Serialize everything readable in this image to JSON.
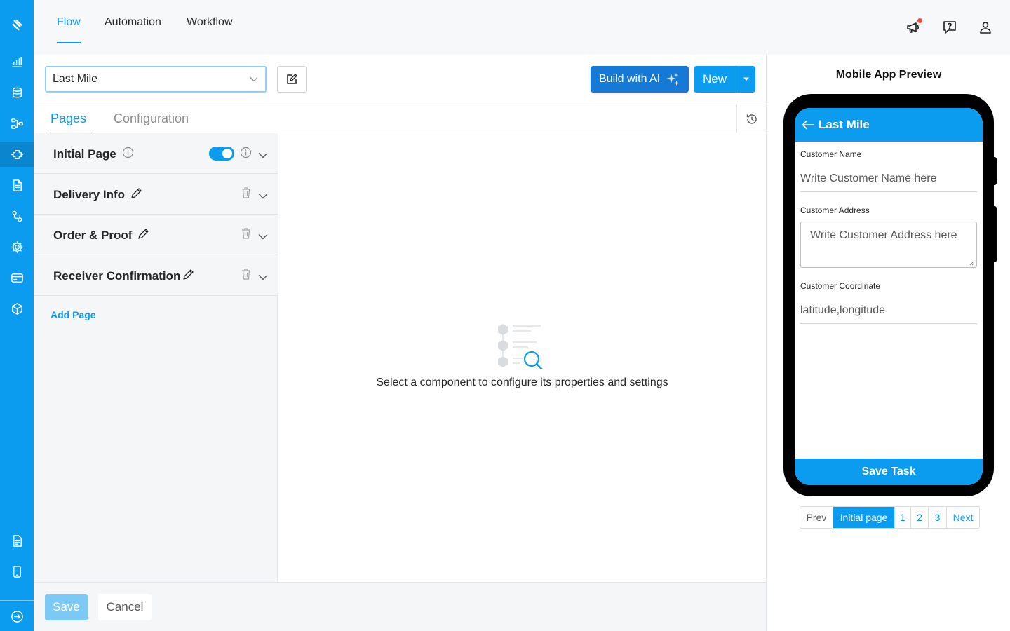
{
  "top_nav": {
    "tabs": [
      {
        "label": "Flow",
        "active": true
      },
      {
        "label": "Automation",
        "active": false
      },
      {
        "label": "Workflow",
        "active": false
      }
    ],
    "icons": [
      "megaphone-icon",
      "help-chat-icon",
      "user-icon"
    ]
  },
  "sidebar": {
    "icons": [
      "logo-icon",
      "analytics-icon",
      "database-icon",
      "flow-icon",
      "integration-icon",
      "document-icon",
      "route-icon",
      "settings-icon",
      "billing-icon",
      "package-icon",
      "notes-icon",
      "mobile-icon",
      "expand-icon"
    ],
    "active": "integration-icon"
  },
  "toolbar": {
    "flow_select_value": "Last Mile",
    "build_ai_label": "Build with AI",
    "new_label": "New"
  },
  "tabs": {
    "pages_label": "Pages",
    "configuration_label": "Configuration",
    "active": "Pages"
  },
  "pages": {
    "items": [
      {
        "label": "Initial Page",
        "enabled": true
      },
      {
        "label": "Delivery Info"
      },
      {
        "label": "Order & Proof"
      },
      {
        "label": "Receiver Confirmation"
      }
    ],
    "add_label": "Add Page"
  },
  "empty_state": {
    "message": "Select a component to configure its properties and settings"
  },
  "footer": {
    "save_label": "Save",
    "cancel_label": "Cancel"
  },
  "preview": {
    "title": "Mobile App Preview",
    "app_title": "Last Mile",
    "fields": [
      {
        "label": "Customer Name",
        "placeholder": "Write Customer Name here"
      },
      {
        "label": "Customer Address",
        "placeholder": "Write Customer Address here"
      },
      {
        "label": "Customer Coordinate",
        "placeholder": "latitude,longitude"
      }
    ],
    "save_task_label": "Save Task",
    "pagination": {
      "prev": "Prev",
      "current": "Initial page",
      "pages": [
        "1",
        "2",
        "3"
      ],
      "next": "Next"
    }
  },
  "colors": {
    "primary": "#0b9bef",
    "ai_button": "#1679d6",
    "save_disabled": "#7cc9f6",
    "notification_dot": "#ef4b3d"
  }
}
